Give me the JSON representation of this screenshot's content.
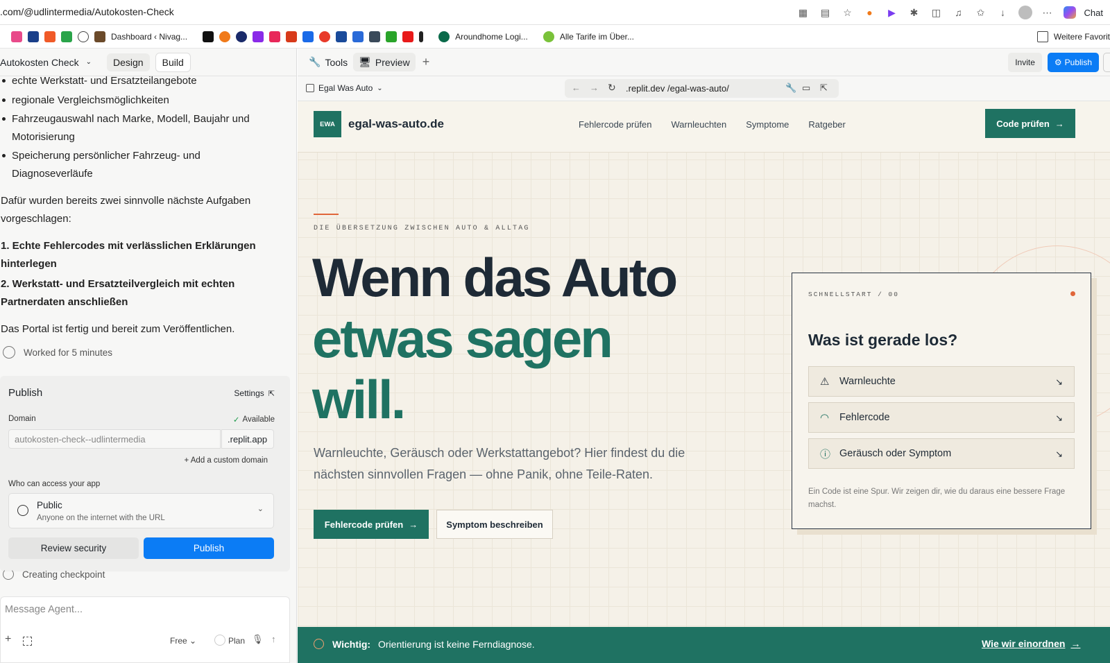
{
  "browser": {
    "url": ".com/@udlintermedia/Autokosten-Check",
    "chat_label": "Chat",
    "bookmarks": [
      "Dashboard ‹ Nivag...",
      "Aroundhome Logi...",
      "Alle Tarife im Über...",
      "Weitere Favorit"
    ]
  },
  "workspace": {
    "project_name": "Autokosten Check",
    "tab_design": "Design",
    "tab_build": "Build",
    "tab_tools": "Tools",
    "tab_preview": "Preview",
    "invite": "Invite",
    "publish": "Publish",
    "preview_title": "Egal Was Auto",
    "preview_url": ".replit.dev /egal-was-auto/"
  },
  "chat": {
    "bullets": [
      "echte Werkstatt- und Ersatzteilangebote",
      "regionale Vergleichsmöglichkeiten",
      "Fahrzeugauswahl nach Marke, Modell, Baujahr und Motorisierung",
      "Speicherung persönlicher Fahrzeug- und Diagnoseverläufe"
    ],
    "para1": "Dafür wurden bereits zwei sinnvolle nächste Aufgaben vorgeschlagen:",
    "tasks": [
      "1. Echte Fehlercodes mit verlässlichen Erklärungen hinterlegen",
      "2. Werkstatt- und Ersatzteilvergleich mit echten Partnerdaten anschließen"
    ],
    "para2": "Das Portal ist fertig und bereit zum Veröffentlichen.",
    "worked": "Worked for 5 minutes",
    "checkpoint": "Creating checkpoint",
    "input_placeholder": "Message Agent...",
    "mode": "Free",
    "plan": "Plan"
  },
  "publish_card": {
    "title": "Publish",
    "settings": "Settings",
    "domain_label": "Domain",
    "available": "Available",
    "domain_value": "autokosten-check--udlintermedia",
    "domain_suffix": ".replit.app",
    "add_domain": "+ Add a custom domain",
    "access_label": "Who can access your app",
    "access_value": "Public",
    "access_desc": "Anyone on the internet with the URL",
    "review": "Review security",
    "publish": "Publish"
  },
  "site": {
    "logo": "EWA",
    "brand": "egal-was-auto.de",
    "nav": [
      "Fehlercode prüfen",
      "Warnleuchten",
      "Symptome",
      "Ratgeber"
    ],
    "cta": "Code prüfen",
    "eyebrow": "DIE ÜBERSETZUNG ZWISCHEN AUTO & ALLTAG",
    "headline1": "Wenn das Auto",
    "headline2": "etwas sagen",
    "headline3": "will.",
    "lead1": "Warnleuchte, Geräusch oder Werkstattangebot? Hier findest du die",
    "lead2": "nächsten sinnvollen Fragen — ohne Panik, ohne Teile-Raten.",
    "btn_primary": "Fehlercode prüfen",
    "btn_secondary": "Symptom beschreiben",
    "card": {
      "eyebrow": "SCHNELLSTART / 00",
      "title": "Was ist gerade los?",
      "options": [
        "Warnleuchte",
        "Fehlercode",
        "Geräusch oder Symptom"
      ],
      "foot1": "Ein Code ist eine Spur. Wir zeigen dir, wie du daraus eine bessere Frage",
      "foot2": "machst."
    },
    "banner": {
      "label": "Wichtig:",
      "text": "Orientierung ist keine Ferndiagnose.",
      "link": "Wie wir einordnen"
    }
  },
  "colors": {
    "green": "#1f7262",
    "accent": "#e0663a",
    "blue": "#0b7cf5",
    "ink": "#1e2a36"
  }
}
